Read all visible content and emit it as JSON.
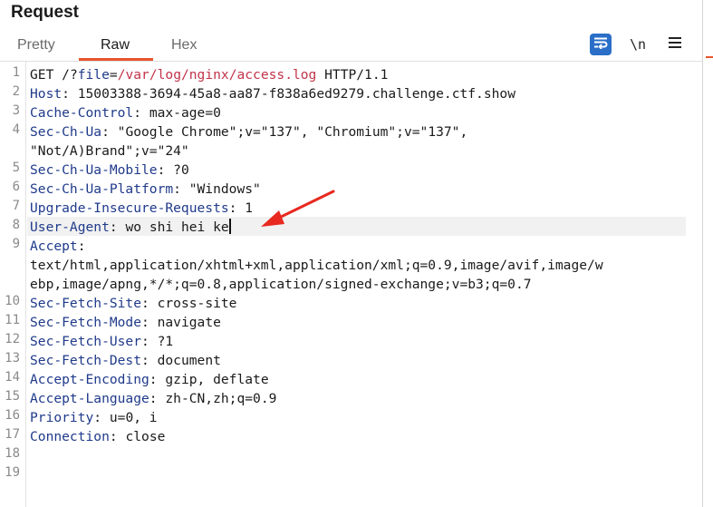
{
  "panel": {
    "title": "Request"
  },
  "tabs": [
    {
      "label": "Pretty"
    },
    {
      "label": "Raw",
      "active": true
    },
    {
      "label": "Hex"
    }
  ],
  "toolbar": {
    "wrap_icon": "word-wrap-icon",
    "newline_label": "\\n",
    "menu_icon": "hamburger-menu-icon"
  },
  "request": {
    "lines": [
      {
        "n": "1",
        "method": "GET ",
        "p1": "/?",
        "p2": "file",
        "p3": "=",
        "p4": "/var/log/nginx/access.log",
        "p5": " HTTP/1.1"
      },
      {
        "n": "2",
        "name": "Host",
        "value": " 15003388-3694-45a8-aa87-f838a6ed9279.challenge.ctf.show"
      },
      {
        "n": "3",
        "name": "Cache-Control",
        "value": " max-age=0"
      },
      {
        "n": "4",
        "name": "Sec-Ch-Ua",
        "value": " \"Google Chrome\";v=\"137\", \"Chromium\";v=\"137\",",
        "cont": "\"Not/A)Brand\";v=\"24\""
      },
      {
        "n": "5",
        "name": "Sec-Ch-Ua-Mobile",
        "value": " ?0"
      },
      {
        "n": "6",
        "name": "Sec-Ch-Ua-Platform",
        "value": " \"Windows\""
      },
      {
        "n": "7",
        "name": "Upgrade-Insecure-Requests",
        "value": " 1"
      },
      {
        "n": "8",
        "name": "User-Agent",
        "value": " wo shi hei ke"
      },
      {
        "n": "9",
        "name": "Accept",
        "value": "",
        "cont": "text/html,application/xhtml+xml,application/xml;q=0.9,image/avif,image/w",
        "cont2": "ebp,image/apng,*/*;q=0.8,application/signed-exchange;v=b3;q=0.7"
      },
      {
        "n": "10",
        "name": "Sec-Fetch-Site",
        "value": " cross-site"
      },
      {
        "n": "11",
        "name": "Sec-Fetch-Mode",
        "value": " navigate"
      },
      {
        "n": "12",
        "name": "Sec-Fetch-User",
        "value": " ?1"
      },
      {
        "n": "13",
        "name": "Sec-Fetch-Dest",
        "value": " document"
      },
      {
        "n": "14",
        "name": "Accept-Encoding",
        "value": " gzip, deflate"
      },
      {
        "n": "15",
        "name": "Accept-Language",
        "value": " zh-CN,zh;q=0.9"
      },
      {
        "n": "16",
        "name": "Priority",
        "value": " u=0, i"
      },
      {
        "n": "17",
        "name": "Connection",
        "value": " close"
      },
      {
        "n": "18"
      },
      {
        "n": "19"
      }
    ]
  },
  "colors": {
    "accent": "#e8542c",
    "header_name": "#1f3a8a",
    "path": "#c2334a",
    "annotation_arrow": "#e8291f"
  }
}
